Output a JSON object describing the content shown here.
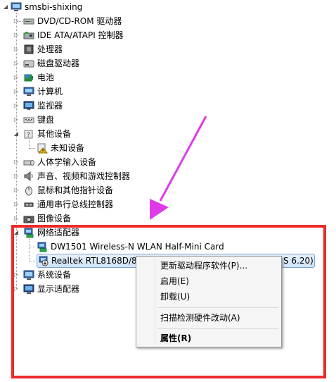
{
  "tree": {
    "root": "smsbi-shixing",
    "items": [
      {
        "label": "DVD/CD-ROM 驱动器"
      },
      {
        "label": "IDE ATA/ATAPI 控制器"
      },
      {
        "label": "处理器"
      },
      {
        "label": "磁盘驱动器"
      },
      {
        "label": "电池"
      },
      {
        "label": "计算机"
      },
      {
        "label": "监视器"
      },
      {
        "label": "键盘"
      },
      {
        "label": "其他设备",
        "children": [
          {
            "label": "未知设备"
          }
        ]
      },
      {
        "label": "人体学输入设备"
      },
      {
        "label": "声音、视频和游戏控制器"
      },
      {
        "label": "鼠标和其他指针设备"
      },
      {
        "label": "通用串行总线控制器"
      },
      {
        "label": "图像设备"
      },
      {
        "label": "网络适配器",
        "children": [
          {
            "label": "DW1501 Wireless-N WLAN Half-Mini Card"
          },
          {
            "label": "Realtek RTL8168D/81",
            "tail": "S 6.20)"
          }
        ]
      },
      {
        "label": "系统设备"
      },
      {
        "label": "显示适配器"
      }
    ]
  },
  "context_menu": {
    "items": [
      "更新驱动程序软件(P)...",
      "启用(E)",
      "卸载(U)",
      "扫描检测硬件改动(A)",
      "属性(R)"
    ]
  },
  "colors": {
    "annotation_box": "#ee2b2b",
    "arrow": "#e03ae8",
    "selection": "#cfe3f8"
  }
}
